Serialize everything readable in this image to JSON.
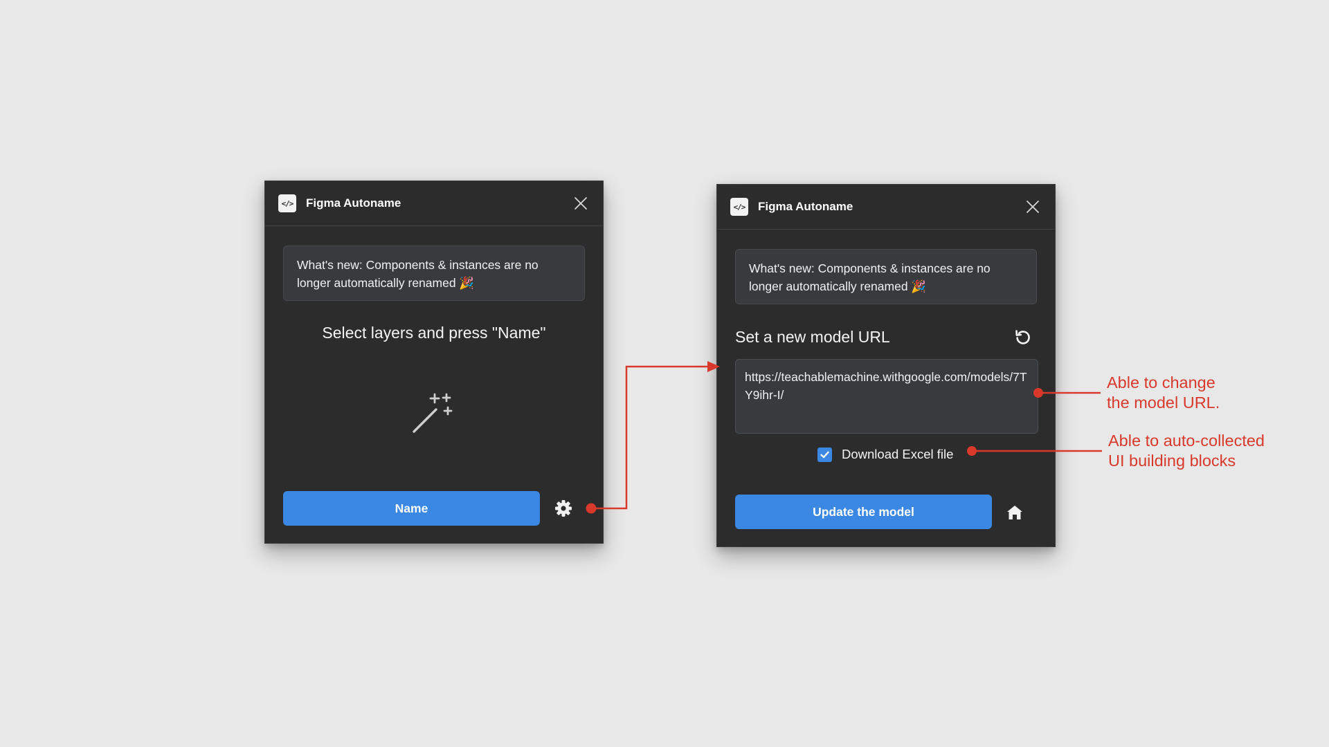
{
  "left_panel": {
    "title": "Figma Autoname",
    "plugin_icon_glyph": "</>",
    "notice": "What's new: Components & instances are no longer automatically renamed 🎉",
    "instruction": "Select layers and press \"Name\"",
    "name_button": "Name",
    "icons": [
      "code-icon",
      "close-icon",
      "magic-wand-icon",
      "gear-icon"
    ]
  },
  "right_panel": {
    "title": "Figma Autoname",
    "plugin_icon_glyph": "</>",
    "notice": "What's new: Components & instances are no longer automatically renamed 🎉",
    "heading": "Set a new model URL",
    "model_url": "https://teachablemachine.withgoogle.com/models/7TY9ihr-I/",
    "checkbox_label": "Download Excel file",
    "checkbox_checked": true,
    "update_button": "Update the model",
    "icons": [
      "code-icon",
      "close-icon",
      "reset-icon",
      "home-icon"
    ]
  },
  "annotations": {
    "url_note_line1": "Able to change",
    "url_note_line2": "the model URL.",
    "excel_note_line1": "Able to auto-collected",
    "excel_note_line2": "UI building blocks"
  },
  "colors": {
    "background": "#e8e8e8",
    "panel": "#2c2c2c",
    "accent_blue": "#3a87e4",
    "annotation_red": "#d9392b"
  }
}
